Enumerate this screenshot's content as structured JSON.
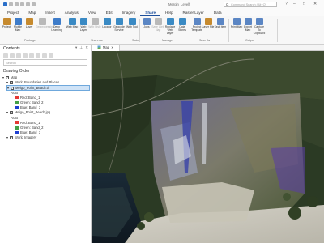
{
  "app": {
    "title": "Mergin_Levelf",
    "command_search_placeholder": "Command Search (Alt+Q)",
    "window_controls": [
      "?",
      "–",
      "□",
      "✕"
    ]
  },
  "tabs": [
    {
      "label": "Project",
      "active": false
    },
    {
      "label": "Map",
      "active": false
    },
    {
      "label": "Insert",
      "active": false
    },
    {
      "label": "Analysis",
      "active": false
    },
    {
      "label": "View",
      "active": false
    },
    {
      "label": "Edit",
      "active": false
    },
    {
      "label": "Imagery",
      "active": false
    },
    {
      "label": "Share",
      "active": true
    },
    {
      "label": "Help",
      "active": false
    },
    {
      "label": "Raster Layer",
      "active": false
    },
    {
      "label": "Data",
      "active": false
    }
  ],
  "ribbon": {
    "buttons": [
      {
        "label": "Project",
        "icon": "package-icon",
        "color": "#c68a2e",
        "enabled": true
      },
      {
        "label": "Mobile Map",
        "icon": "mobile-map-icon",
        "color": "#3e7cc9",
        "enabled": true
      },
      {
        "label": "Layer",
        "icon": "layer-package-icon",
        "color": "#c68a2e",
        "enabled": true
      },
      {
        "label": "Geoprocessing",
        "icon": "geoprocessing-icon",
        "color": "#b9b9b9",
        "enabled": false
      },
      {
        "label": "Deep Learning",
        "icon": "deep-learning-icon",
        "color": "#3e7cc9",
        "enabled": true
      },
      {
        "label": "Web Map",
        "icon": "web-map-icon",
        "color": "#3a8ac4",
        "enabled": true
      },
      {
        "label": "Web Layer",
        "icon": "web-layer-icon",
        "color": "#3a8ac4",
        "enabled": true
      },
      {
        "label": "Web Style",
        "icon": "web-style-icon",
        "color": "#b9b9b9",
        "enabled": false
      },
      {
        "label": "Locator",
        "icon": "locator-icon",
        "color": "#3a8ac4",
        "enabled": true
      },
      {
        "label": "Geocode Service",
        "icon": "geocode-icon",
        "color": "#3a8ac4",
        "enabled": true
      },
      {
        "label": "Web Tool",
        "icon": "web-tool-icon",
        "color": "#3a8ac4",
        "enabled": true
      },
      {
        "label": "Jobs",
        "icon": "jobs-icon",
        "color": "#5b86c4",
        "enabled": true
      },
      {
        "label": "Save Web Map",
        "icon": "save-web-map-icon",
        "color": "#b9b9b9",
        "enabled": false
      },
      {
        "label": "Replace Web Layer",
        "icon": "replace-web-layer-icon",
        "color": "#3a8ac4",
        "enabled": true
      },
      {
        "label": "Data Stores",
        "icon": "data-stores-icon",
        "color": "#3a8ac4",
        "enabled": true
      },
      {
        "label": "Project Template",
        "icon": "project-template-icon",
        "color": "#5b86c4",
        "enabled": true
      },
      {
        "label": "Layer File",
        "icon": "layer-file-icon",
        "color": "#c68a2e",
        "enabled": true
      },
      {
        "label": "Task Item",
        "icon": "task-item-icon",
        "color": "#5b86c4",
        "enabled": true
      },
      {
        "label": "Print Map",
        "icon": "print-icon",
        "color": "#5b86c4",
        "enabled": true
      },
      {
        "label": "Export Map",
        "icon": "export-map-icon",
        "color": "#5b86c4",
        "enabled": true
      },
      {
        "label": "Capture To Clipboard",
        "icon": "clipboard-icon",
        "color": "#5b86c4",
        "enabled": true
      }
    ],
    "groups": [
      "Package",
      "Share As",
      "Status",
      "Manage",
      "Save As",
      "Output"
    ]
  },
  "contents_pane": {
    "title": "Contents",
    "search_placeholder": "Search",
    "drawing_order_label": "Drawing Order",
    "tree": [
      {
        "label": "Map",
        "level": 0,
        "checked": true,
        "selected": false
      },
      {
        "label": "World Boundaries and Places",
        "level": 1,
        "checked": true,
        "selected": false
      },
      {
        "label": "Meigo_Point_Beach.tif",
        "level": 1,
        "checked": true,
        "selected": true
      },
      {
        "label": "RGB",
        "level": 2,
        "heading": true
      },
      {
        "label": "Red:  Band_1",
        "level": 3,
        "swatch": "#e53935"
      },
      {
        "label": "Green:  Band_2",
        "level": 3,
        "swatch": "#43a047"
      },
      {
        "label": "Blue:  Band_3",
        "level": 3,
        "swatch": "#1e3fd1"
      },
      {
        "label": "Meigo_Point_Beach.jpg",
        "level": 1,
        "checked": true,
        "selected": false
      },
      {
        "label": "RGB",
        "level": 2,
        "heading": true
      },
      {
        "label": "Red:  Band_1",
        "level": 3,
        "swatch": "#e53935"
      },
      {
        "label": "Green:  Band_2",
        "level": 3,
        "swatch": "#43a047"
      },
      {
        "label": "Blue:  Band_3",
        "level": 3,
        "swatch": "#1e3fd1"
      },
      {
        "label": "World Imagery",
        "level": 1,
        "checked": true,
        "selected": false
      }
    ]
  },
  "map_view": {
    "tab_label": "Map"
  }
}
